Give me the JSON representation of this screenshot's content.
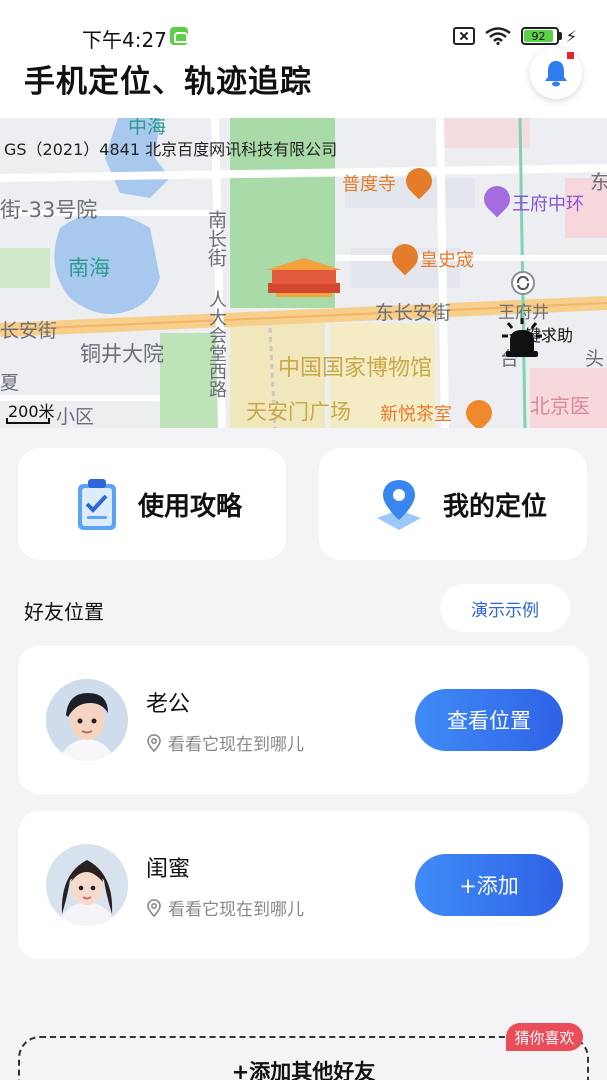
{
  "status_bar": {
    "time": "下午4:27",
    "battery_level": "92",
    "icons": [
      "app-notification-icon",
      "sim-off-icon",
      "wifi-icon",
      "battery-icon",
      "charging-icon"
    ]
  },
  "header": {
    "title": "手机定位、轨迹追踪",
    "bell_icon": "bell-icon"
  },
  "map": {
    "copyright": "GS（2021）4841 北京百度网讯科技有限公司",
    "labels": {
      "nanhai": "南海",
      "jie33": "街-33号院",
      "nanchangjie": "南长街",
      "tongjing": "铜井大院",
      "renda": "人大会堂西路",
      "changanjie_left": "长安街",
      "dongchangan": "东长安街",
      "wangfujing_top": "王府井",
      "museum": "中国国家博物馆",
      "tiananmen": "天安门广场",
      "xiaoqu": "小区",
      "puduosi": "普度寺",
      "wangfu_mall": "王府中环",
      "huangshicheng": "皇史宬",
      "xinyue": "新悦茶室",
      "zhonghai_top": "中海",
      "east_edge": "东",
      "tai": "台",
      "tou": "头",
      "beijing_hospital": "北京医",
      "xia": "夏"
    },
    "scale": "200米",
    "sos_label": "一键求助"
  },
  "quick_actions": [
    {
      "label": "使用攻略",
      "icon": "clipboard-icon"
    },
    {
      "label": "我的定位",
      "icon": "location-pin-icon"
    }
  ],
  "friends_section": {
    "title": "好友位置",
    "demo_label": "演示示例"
  },
  "friends": [
    {
      "name": "老公",
      "subtitle": "看看它现在到哪儿",
      "button": "查看位置"
    },
    {
      "name": "闺蜜",
      "subtitle": "看看它现在到哪儿",
      "button": "+添加"
    }
  ],
  "add_others": {
    "label": "+添加其他好友",
    "badge": "猜你喜欢"
  },
  "colors": {
    "accent": "#2f62e6",
    "badge": "#e94d5a",
    "park": "#a9dba8",
    "water": "#a8c8ee"
  }
}
